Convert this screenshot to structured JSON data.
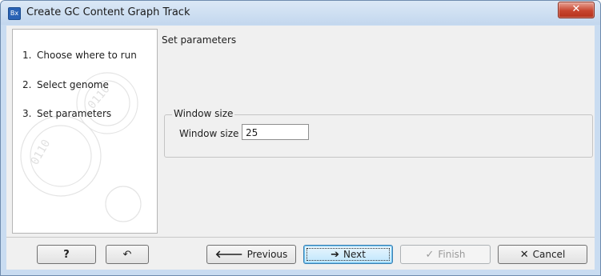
{
  "window": {
    "title": "Create GC Content Graph Track",
    "app_icon_text": "Bx",
    "close_glyph": "✕"
  },
  "steps": [
    {
      "number": "1.",
      "label": "Choose where to run"
    },
    {
      "number": "2.",
      "label": "Select genome"
    },
    {
      "number": "3.",
      "label": "Set parameters"
    }
  ],
  "content": {
    "heading": "Set parameters",
    "group_title": "Window size",
    "field_label": "Window size",
    "field_value": "25"
  },
  "buttons": {
    "help": {
      "glyph": "?"
    },
    "reset": {
      "glyph": "↶"
    },
    "previous": {
      "glyph": "🡐",
      "label": "Previous"
    },
    "next": {
      "glyph": "➔",
      "label": "Next"
    },
    "finish": {
      "glyph": "✓",
      "label": "Finish"
    },
    "cancel": {
      "glyph": "✕",
      "label": "Cancel"
    }
  }
}
